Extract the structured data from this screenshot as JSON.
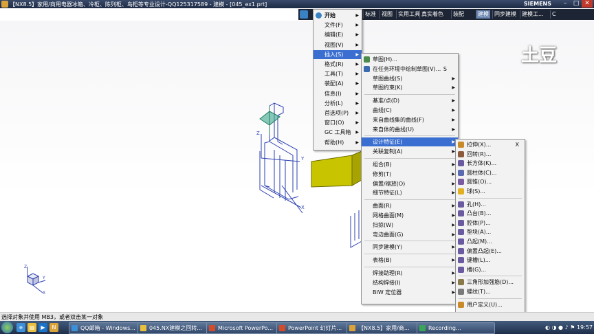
{
  "window": {
    "title": "【NX8.5】家用/商用电器冰箱、冷柜、陈列柜、岛柜等专业设计-QQ125317589 - 建模 - [045_ex1.prt]",
    "brand": "SIEMENS"
  },
  "toolbar_tabs": [
    "标准",
    "视图",
    "实用工具",
    "真实着色",
    "装配",
    "建模",
    "同步建模",
    "建模工...",
    "C"
  ],
  "active_tab": "建模",
  "watermark": "土豆",
  "start_menu": [
    {
      "label": "开始",
      "bold": true
    },
    {
      "label": "文件(F)"
    },
    {
      "label": "编辑(E)"
    },
    {
      "label": "视图(V)"
    },
    {
      "label": "插入(S)",
      "highlighted": true
    },
    {
      "label": "格式(R)"
    },
    {
      "label": "工具(T)"
    },
    {
      "label": "装配(A)"
    },
    {
      "label": "信息(I)"
    },
    {
      "label": "分析(L)"
    },
    {
      "label": "首选项(P)"
    },
    {
      "label": "窗口(O)"
    },
    {
      "label": "GC 工具箱"
    },
    {
      "label": "帮助(H)"
    }
  ],
  "insert_menu": [
    {
      "label": "草图(H)...",
      "icon": "sketch-icon"
    },
    {
      "label": "在任务环境中绘制草图(V)...",
      "shortcut": "S",
      "icon": "sketch-task-icon"
    },
    {
      "label": "草图曲线(S)",
      "submenu": true
    },
    {
      "label": "草图约束(K)",
      "submenu": true
    },
    {
      "sep": true
    },
    {
      "label": "基准/点(D)",
      "submenu": true
    },
    {
      "label": "曲线(C)",
      "submenu": true
    },
    {
      "label": "来自曲线集的曲线(F)",
      "submenu": true
    },
    {
      "label": "来自体的曲线(U)",
      "submenu": true
    },
    {
      "sep": true
    },
    {
      "label": "设计特征(E)",
      "submenu": true,
      "highlighted": true
    },
    {
      "label": "关联复制(A)",
      "submenu": true
    },
    {
      "sep": true
    },
    {
      "label": "组合(B)",
      "submenu": true
    },
    {
      "label": "修剪(T)",
      "submenu": true
    },
    {
      "label": "偏置/缩放(O)",
      "submenu": true
    },
    {
      "label": "细节特征(L)",
      "submenu": true
    },
    {
      "sep": true
    },
    {
      "label": "曲面(R)",
      "submenu": true
    },
    {
      "label": "网格曲面(M)",
      "submenu": true
    },
    {
      "label": "扫掠(W)",
      "submenu": true
    },
    {
      "label": "弯边曲面(G)",
      "submenu": true
    },
    {
      "sep": true
    },
    {
      "label": "同步建模(Y)",
      "submenu": true
    },
    {
      "sep": true
    },
    {
      "label": "表格(B)",
      "submenu": true
    },
    {
      "sep": true
    },
    {
      "label": "焊接助理(R)",
      "submenu": true
    },
    {
      "label": "结构焊接(I)",
      "submenu": true
    },
    {
      "label": "BIW 定位器",
      "submenu": true
    }
  ],
  "design_feature_menu": [
    {
      "label": "拉伸(X)...",
      "shortcut": "X",
      "icon": "extrude-icon",
      "color": "#c98a2a"
    },
    {
      "label": "回转(R)...",
      "icon": "revolve-icon",
      "color": "#8a5a3a"
    },
    {
      "label": "长方体(K)...",
      "icon": "block-icon",
      "color": "#6a5aa0"
    },
    {
      "label": "圆柱体(C)...",
      "icon": "cylinder-icon",
      "color": "#5a6ab0"
    },
    {
      "label": "圆锥(O)...",
      "icon": "cone-icon",
      "color": "#7a5aa0"
    },
    {
      "label": "球(S)...",
      "icon": "sphere-icon",
      "color": "#e0b020"
    },
    {
      "sep": true
    },
    {
      "label": "孔(H)...",
      "icon": "hole-icon",
      "color": "#6a5aa0"
    },
    {
      "label": "凸台(B)...",
      "icon": "boss-icon",
      "color": "#6a5aa0"
    },
    {
      "label": "腔体(P)...",
      "icon": "pocket-icon",
      "color": "#6a5aa0"
    },
    {
      "label": "垫块(A)...",
      "icon": "pad-icon",
      "color": "#6a5aa0"
    },
    {
      "label": "凸起(M)...",
      "icon": "emboss-icon",
      "color": "#6a5aa0"
    },
    {
      "label": "偏置凸起(E)...",
      "icon": "offset-emboss-icon",
      "color": "#6a5aa0"
    },
    {
      "label": "键槽(L)...",
      "icon": "slot-icon",
      "color": "#6a5aa0"
    },
    {
      "label": "槽(G)...",
      "icon": "groove-icon",
      "color": "#6a5aa0"
    },
    {
      "sep": true
    },
    {
      "label": "三角形加强筋(D)...",
      "icon": "dart-icon",
      "color": "#8a7a4a"
    },
    {
      "label": "螺纹(T)...",
      "icon": "thread-icon",
      "color": "#7a7a7a"
    },
    {
      "sep": true
    },
    {
      "label": "用户定义(U)...",
      "icon": "udf-icon",
      "color": "#c98a2a"
    }
  ],
  "status": "选择对象并使用 MB3，或者双击某一对象",
  "taskbar": {
    "tasks": [
      {
        "label": "QQ邮箱 - Windows...",
        "color": "#3d8fd8"
      },
      {
        "label": "045.NX建模之回转...",
        "color": "#e8c040"
      },
      {
        "label": "Microsoft PowerPo...",
        "color": "#d24b2a"
      },
      {
        "label": "PowerPoint 幻灯片...",
        "color": "#d24b2a"
      },
      {
        "label": "【NX8.5】家用/商...",
        "color": "#d9a33a"
      },
      {
        "label": "Recording...",
        "color": "#3aa55a"
      }
    ],
    "clock": "19:57"
  },
  "colors": {
    "highlight": "#3a6fd1",
    "wire": "#2b3fb0",
    "solid_fill": "#c8c400",
    "teal": "#3aa88a"
  }
}
